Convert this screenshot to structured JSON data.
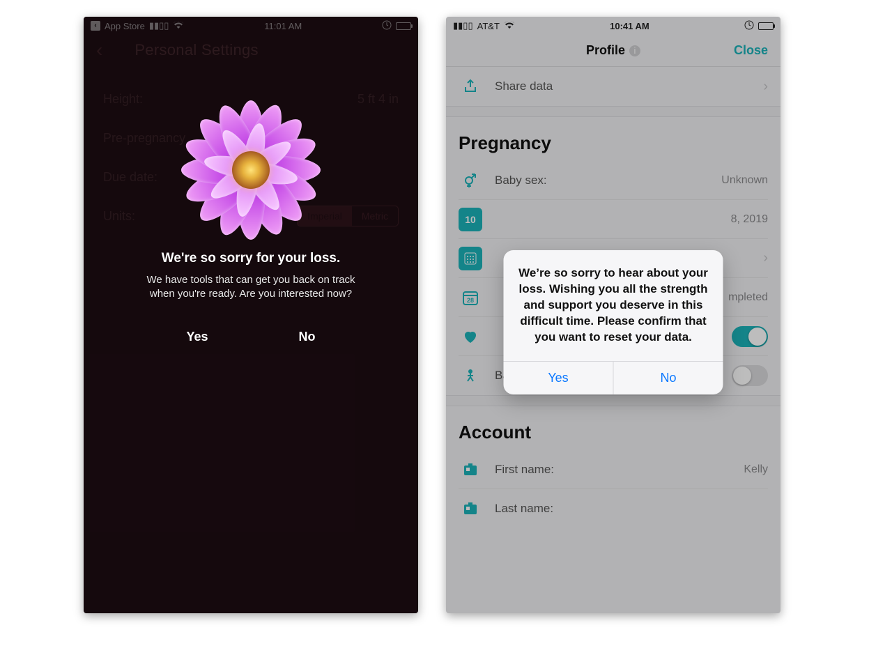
{
  "left": {
    "status": {
      "back_app": "App Store",
      "time": "11:01 AM"
    },
    "nav_title": "Personal Settings",
    "rows": {
      "height_label": "Height:",
      "height_value": "5 ft 4 in",
      "pp_label": "Pre-pregnancy",
      "due_label": "Due date:",
      "units_label": "Units:",
      "units_imperial": "Imperial",
      "units_metric": "Metric"
    },
    "dialog": {
      "title": "We're so sorry for your loss.",
      "body": "We have tools that can get you back on track when you're ready. Are you interested now?",
      "yes": "Yes",
      "no": "No"
    }
  },
  "right": {
    "status": {
      "carrier": "AT&T",
      "time": "10:41 AM"
    },
    "nav": {
      "title": "Profile",
      "close": "Close"
    },
    "share": "Share data",
    "preg_header": "Pregnancy",
    "preg": {
      "sex_label": "Baby sex:",
      "sex_value": "Unknown",
      "due_value": "8, 2019",
      "survey_value": "mpleted",
      "born_label": "Baby already born?"
    },
    "alert": {
      "msg": "We’re so sorry to hear about your loss. Wishing you all the strength and support you deserve in this difficult time. Please confirm that you want to reset your data.",
      "yes": "Yes",
      "no": "No"
    },
    "acct_header": "Account",
    "acct": {
      "first_label": "First name:",
      "first_value": "Kelly",
      "last_label": "Last name:"
    }
  }
}
